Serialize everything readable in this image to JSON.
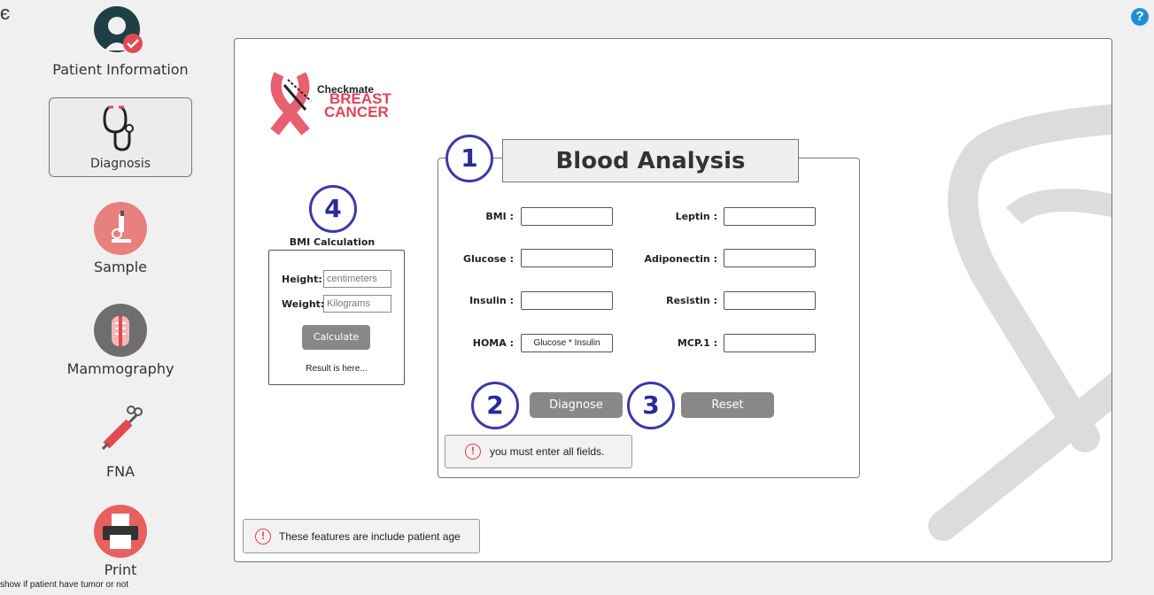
{
  "corner_glyph": "є",
  "help_icon": "?",
  "sidebar": {
    "items": [
      {
        "label": "Patient Information"
      },
      {
        "label": "Diagnosis"
      },
      {
        "label": "Sample"
      },
      {
        "label": "Mammography"
      },
      {
        "label": "FNA"
      },
      {
        "label": "Print"
      }
    ],
    "selected": "Diagnosis"
  },
  "bottom_note": "show if patient have tumor or not",
  "logo": {
    "line1": "Checkmate",
    "line2": "BREAST",
    "line3": "CANCER"
  },
  "bmi": {
    "step": "4",
    "title": "BMI Calculation",
    "height_label": "Height:",
    "height_placeholder": "centimeters",
    "weight_label": "Weight:",
    "weight_placeholder": "Kilograms",
    "calculate_label": "Calculate",
    "result": "Result is here..."
  },
  "blood": {
    "step": "1",
    "title": "Blood Analysis",
    "fields": {
      "bmi": "BMI :",
      "glucose": "Glucose :",
      "insulin": "Insulin :",
      "homa": "HOMA :",
      "homa_value": "Glucose * Insulin",
      "leptin": "Leptin :",
      "adiponectin": "Adiponectin :",
      "resistin": "Resistin :",
      "mcp": "MCP.1 :"
    }
  },
  "actions": {
    "diagnose_step": "2",
    "diagnose_label": "Diagnose",
    "reset_step": "3",
    "reset_label": "Reset"
  },
  "warnings": {
    "fields": "you must enter all fields.",
    "features": "These features are include patient age"
  },
  "colors": {
    "accent": "#3a3aa8",
    "brand": "#e0455a",
    "button": "#888888"
  }
}
